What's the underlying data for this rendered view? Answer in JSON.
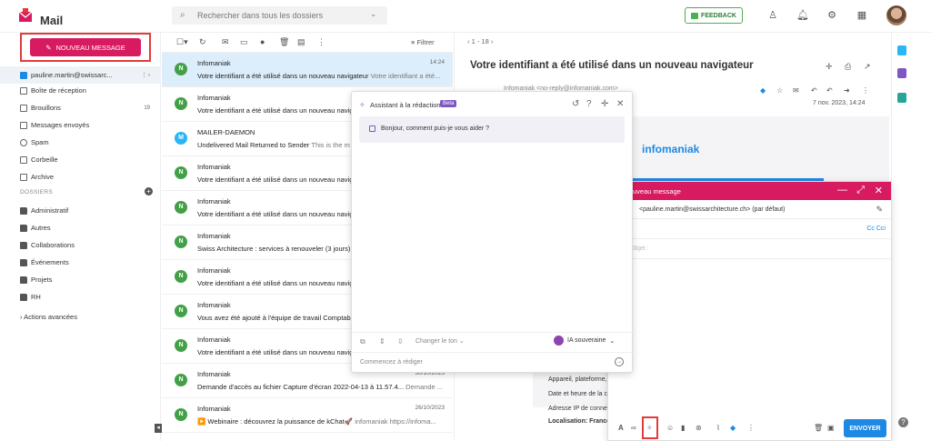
{
  "app": {
    "title": "Mail"
  },
  "search": {
    "placeholder": "Rechercher dans tous les dossiers"
  },
  "header": {
    "feedback": "FEEDBACK"
  },
  "sidebar": {
    "new_message": "NOUVEAU MESSAGE",
    "account": "pauline.martin@swissarc...",
    "items": [
      {
        "label": "Boîte de réception",
        "icon": "inbox-icon"
      },
      {
        "label": "Brouillons",
        "icon": "draft-icon",
        "count": "19"
      },
      {
        "label": "Messages envoyés",
        "icon": "send-icon"
      },
      {
        "label": "Spam",
        "icon": "spam-icon"
      },
      {
        "label": "Corbeille",
        "icon": "trash-icon"
      },
      {
        "label": "Archive",
        "icon": "archive-icon"
      }
    ],
    "dossiers_label": "DOSSIERS",
    "folders": [
      "Administratif",
      "Autres",
      "Collaborations",
      "Événements",
      "Projets",
      "RH"
    ],
    "actions": "Actions avancées"
  },
  "list": {
    "filter": "Filtrer",
    "pager": "1 - 18",
    "rows": [
      {
        "avatar": "N",
        "from": "Infomaniak",
        "date": "14:24",
        "subject": "Votre identifiant a été utilisé dans un nouveau navigateur",
        "preview": "Votre identifiant a été..."
      },
      {
        "avatar": "N",
        "from": "Infomaniak",
        "date": "",
        "subject": "Votre identifiant a été utilisé dans un nouveau navig",
        "preview": ""
      },
      {
        "avatar": "M",
        "from": "MAILER-DAEMON",
        "date": "",
        "subject": "Undelivered Mail Returned to Sender",
        "preview": "This is the m"
      },
      {
        "avatar": "N",
        "from": "Infomaniak",
        "date": "",
        "subject": "Votre identifiant a été utilisé dans un nouveau navig",
        "preview": ""
      },
      {
        "avatar": "N",
        "from": "Infomaniak",
        "date": "",
        "subject": "Votre identifiant a été utilisé dans un nouveau navig",
        "preview": ""
      },
      {
        "avatar": "N",
        "from": "Infomaniak",
        "date": "",
        "subject": "Swiss Architecture : services à renouveler (3 jours)",
        "preview": ""
      },
      {
        "avatar": "N",
        "from": "Infomaniak",
        "date": "",
        "subject": "Votre identifiant a été utilisé dans un nouveau navig",
        "preview": ""
      },
      {
        "avatar": "N",
        "from": "Infomaniak",
        "date": "",
        "subject": "Vous avez été ajouté à l'équipe de travail Comptabi",
        "preview": ""
      },
      {
        "avatar": "N",
        "from": "Infomaniak",
        "date": "",
        "subject": "Votre identifiant a été utilisé dans un nouveau navig",
        "preview": ""
      },
      {
        "avatar": "N",
        "from": "Infomaniak",
        "date": "30/10/2023",
        "subject": "Demande d'accès au fichier Capture d'écran 2022-04-13 à 11.57.4...",
        "preview": "Demande ..."
      },
      {
        "avatar": "N",
        "from": "Infomaniak",
        "date": "26/10/2023",
        "subject": "▶️ Webinaire : découvrez la puissance de kChat🚀",
        "preview": "infomaniak https://infoma..."
      }
    ]
  },
  "reader": {
    "title": "Votre identifiant a été utilisé dans un nouveau navigateur",
    "sender": "Infomaniak  <no-reply@infomaniak.com>",
    "date": "7 nov. 2023, 14:24",
    "brand": "infomaniak",
    "lines": [
      "Appareil, plateforme,",
      "Date et heure de la c",
      "Adresse IP de conne",
      "Localisation: France"
    ]
  },
  "assistant": {
    "title": "Assistant à la rédaction",
    "beta": "Beta",
    "greeting": "Bonjour, comment puis-je vous aider ?",
    "tone": "Changer le ton",
    "model": "IA souveraine",
    "placeholder": "Commencez à rédiger"
  },
  "compose": {
    "title": "uveau message",
    "from": "<pauline.martin@swissarchitecture.ch> (par défaut)",
    "cc": "Cc Cci",
    "subject_ph": "Objet :",
    "send": "ENVOYER"
  },
  "colors": {
    "brand": "#d81b60",
    "accent": "#1e88e5",
    "ai": "#7e57c2"
  }
}
